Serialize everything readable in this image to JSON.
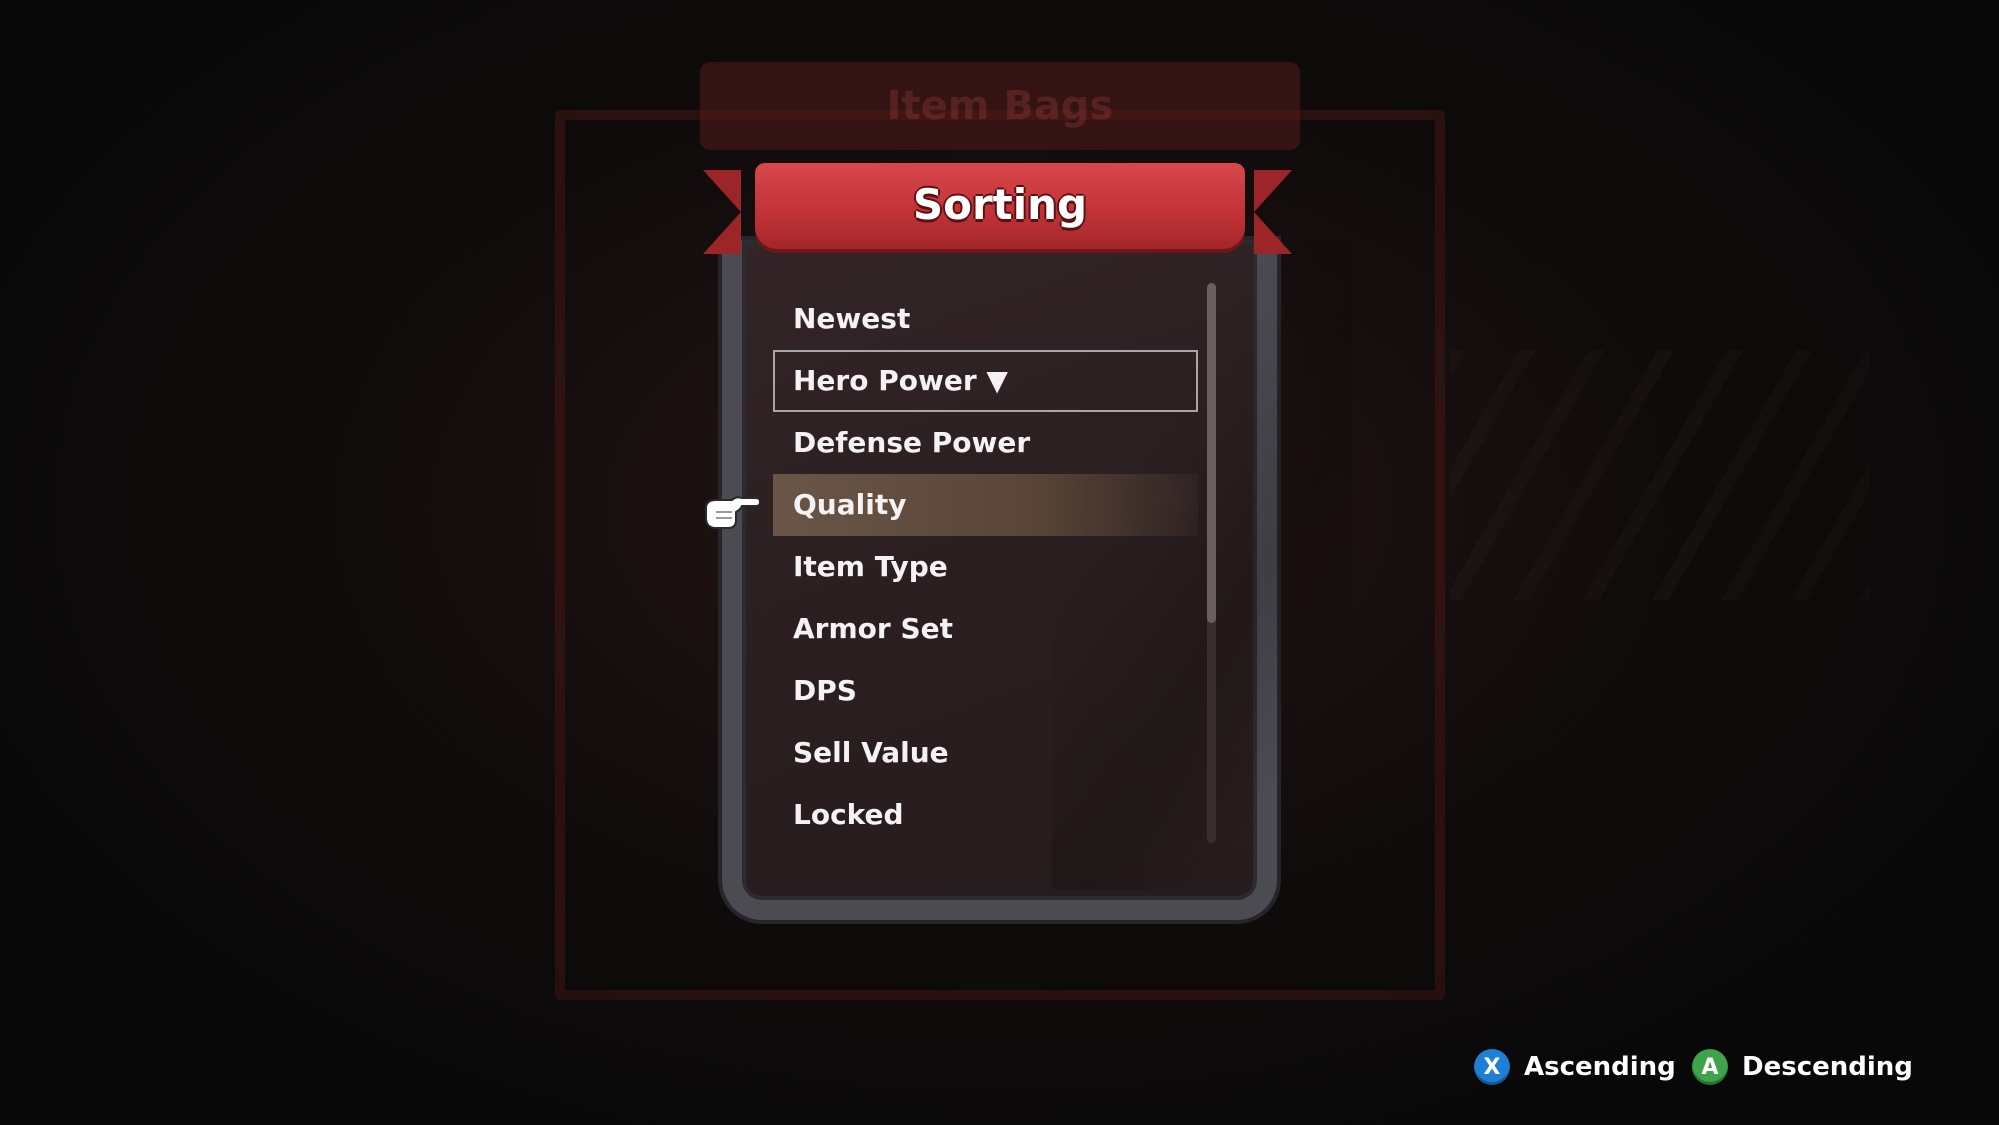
{
  "background": {
    "menu_title": "Item Bags"
  },
  "dialog": {
    "title": "Sorting",
    "options": [
      {
        "label": "Newest"
      },
      {
        "label": "Hero Power ▼"
      },
      {
        "label": "Defense Power"
      },
      {
        "label": "Quality"
      },
      {
        "label": "Item Type"
      },
      {
        "label": "Armor Set"
      },
      {
        "label": "DPS"
      },
      {
        "label": "Sell Value"
      },
      {
        "label": "Locked"
      }
    ],
    "active_sort": "Hero Power",
    "active_sort_direction": "descending",
    "hovered_option": "Quality",
    "cursor_icon": "pointing-hand-icon"
  },
  "prompts": [
    {
      "button": "X",
      "label": "Ascending",
      "color": "#1f7fd6",
      "icon": "x-button-icon"
    },
    {
      "button": "A",
      "label": "Descending",
      "color": "#3fa34a",
      "icon": "a-button-icon"
    }
  ],
  "colors": {
    "banner": "#c23438",
    "frame": "#4c4b52",
    "panel": "#2a1e20",
    "hover_highlight": "#6a5549"
  }
}
